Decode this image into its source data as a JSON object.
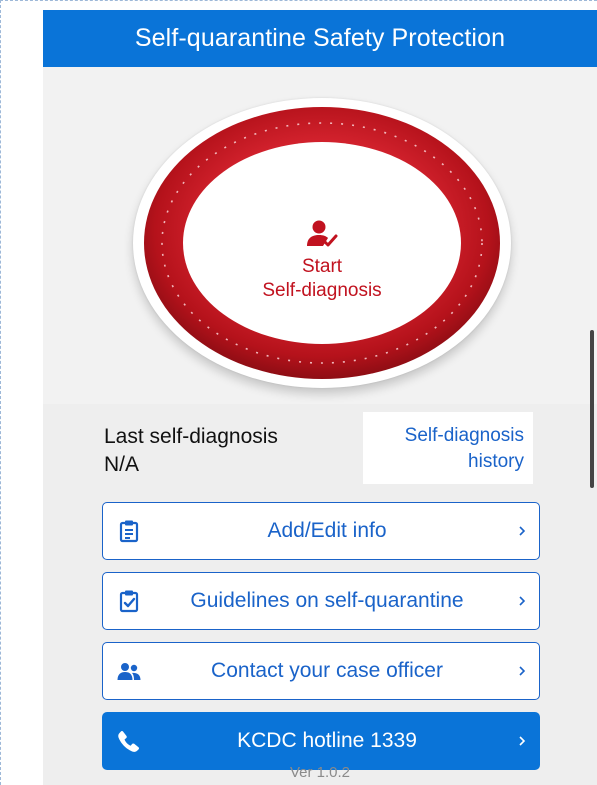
{
  "header": {
    "title": "Self-quarantine Safety Protection"
  },
  "start": {
    "line1": "Start",
    "line2": "Self-diagnosis",
    "icon": "person-check-icon"
  },
  "last_diagnosis": {
    "label": "Last self-diagnosis",
    "value": "N/A"
  },
  "history": {
    "line1": "Self-diagnosis",
    "line2": "history"
  },
  "actions": [
    {
      "label": "Add/Edit info",
      "icon": "clipboard-icon"
    },
    {
      "label": "Guidelines on self-quarantine",
      "icon": "clipboard-check-icon"
    },
    {
      "label": "Contact your case officer",
      "icon": "users-icon"
    },
    {
      "label": "KCDC hotline 1339",
      "icon": "phone-icon"
    }
  ],
  "footer": {
    "version": "Ver 1.0.2"
  },
  "colors": {
    "brand_blue": "#0a74d8",
    "link_blue": "#1a63c9",
    "ring_red": "#b5121b",
    "text_red": "#c1121f"
  }
}
